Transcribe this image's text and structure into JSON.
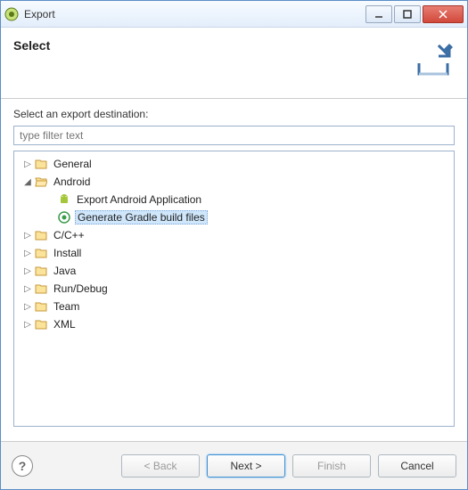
{
  "window": {
    "title": "Export"
  },
  "header": {
    "title": "Select"
  },
  "content": {
    "prompt": "Select an export destination:",
    "filter_placeholder": "type filter text"
  },
  "tree": {
    "general": "General",
    "android": "Android",
    "android_export_app": "Export Android Application",
    "android_gradle": "Generate Gradle build files",
    "ccpp": "C/C++",
    "install": "Install",
    "java": "Java",
    "rundebug": "Run/Debug",
    "team": "Team",
    "xml": "XML"
  },
  "buttons": {
    "back": "< Back",
    "next": "Next >",
    "finish": "Finish",
    "cancel": "Cancel"
  }
}
